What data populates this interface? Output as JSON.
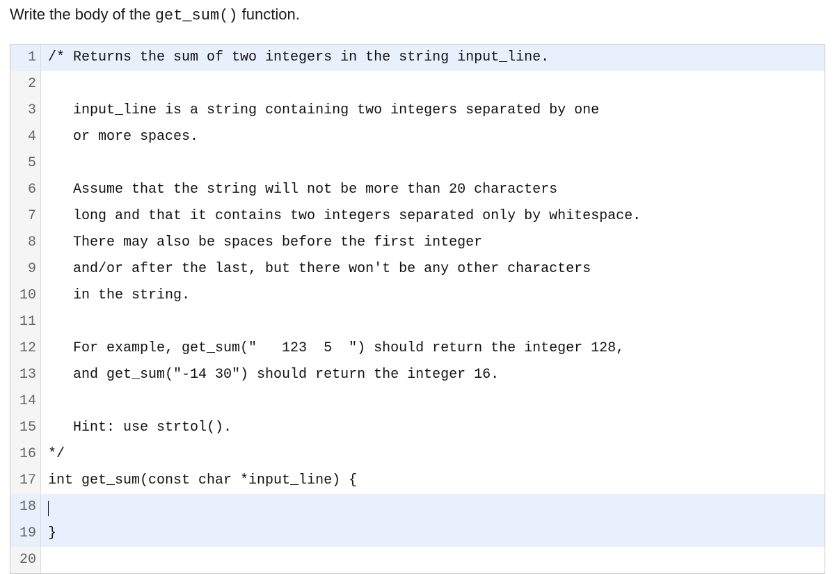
{
  "instruction": {
    "prefix": "Write the body of the ",
    "code": "get_sum()",
    "suffix": " function."
  },
  "code": {
    "highlighted_lines": [
      1,
      18,
      19
    ],
    "cursor_line": 18,
    "lines": [
      "/* Returns the sum of two integers in the string input_line.",
      "",
      "   input_line is a string containing two integers separated by one",
      "   or more spaces.",
      "",
      "   Assume that the string will not be more than 20 characters",
      "   long and that it contains two integers separated only by whitespace.",
      "   There may also be spaces before the first integer",
      "   and/or after the last, but there won't be any other characters",
      "   in the string.",
      "",
      "   For example, get_sum(\"   123  5  \") should return the integer 128,",
      "   and get_sum(\"-14 30\") should return the integer 16.",
      "",
      "   Hint: use strtol().",
      "*/",
      "int get_sum(const char *input_line) {",
      "",
      "}",
      ""
    ]
  }
}
